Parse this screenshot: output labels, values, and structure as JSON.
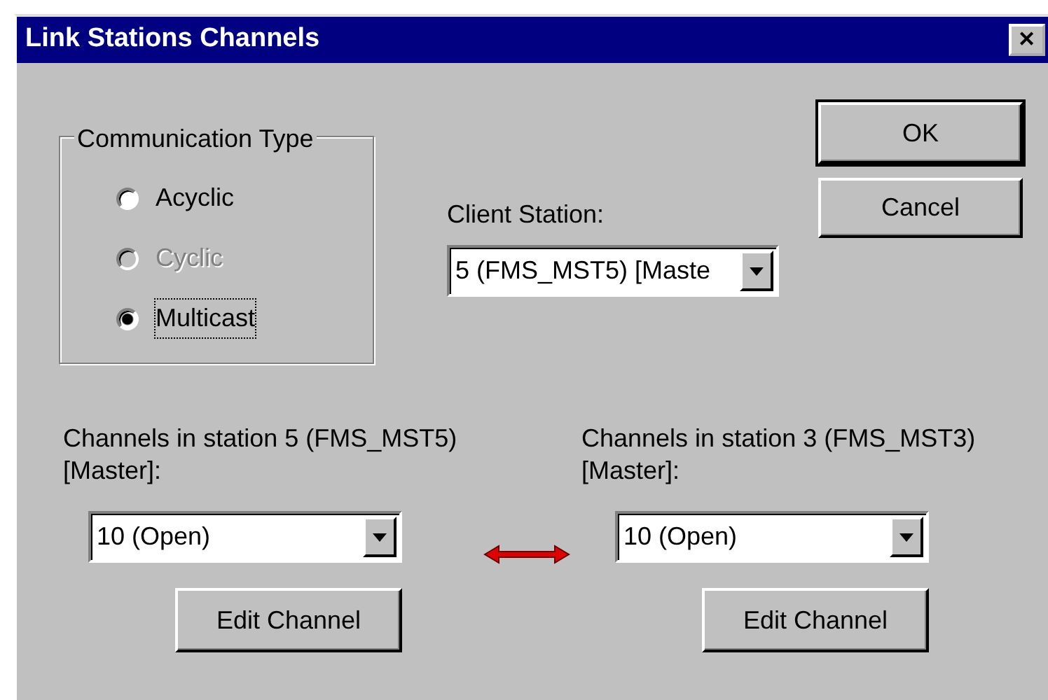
{
  "window": {
    "title": "Link Stations Channels",
    "close": "✕"
  },
  "communication_type": {
    "label": "Communication Type",
    "options": [
      {
        "label": "Acyclic",
        "selected": false,
        "disabled": false
      },
      {
        "label": "Cyclic",
        "selected": false,
        "disabled": true
      },
      {
        "label": "Multicast",
        "selected": true,
        "disabled": false
      }
    ]
  },
  "client_station": {
    "label": "Client Station:",
    "value": "5 (FMS_MST5) [Maste"
  },
  "buttons": [
    {
      "label": "OK",
      "default": true
    },
    {
      "label": "Cancel",
      "default": false
    }
  ],
  "channels": [
    {
      "label": "Channels in station 5 (FMS_MST5) [Master]:",
      "value": "10 (Open)",
      "button": "Edit Channel"
    },
    {
      "label": "Channels in station 3 (FMS_MST3) [Master]:",
      "value": "10 (Open)",
      "button": "Edit Channel"
    }
  ]
}
